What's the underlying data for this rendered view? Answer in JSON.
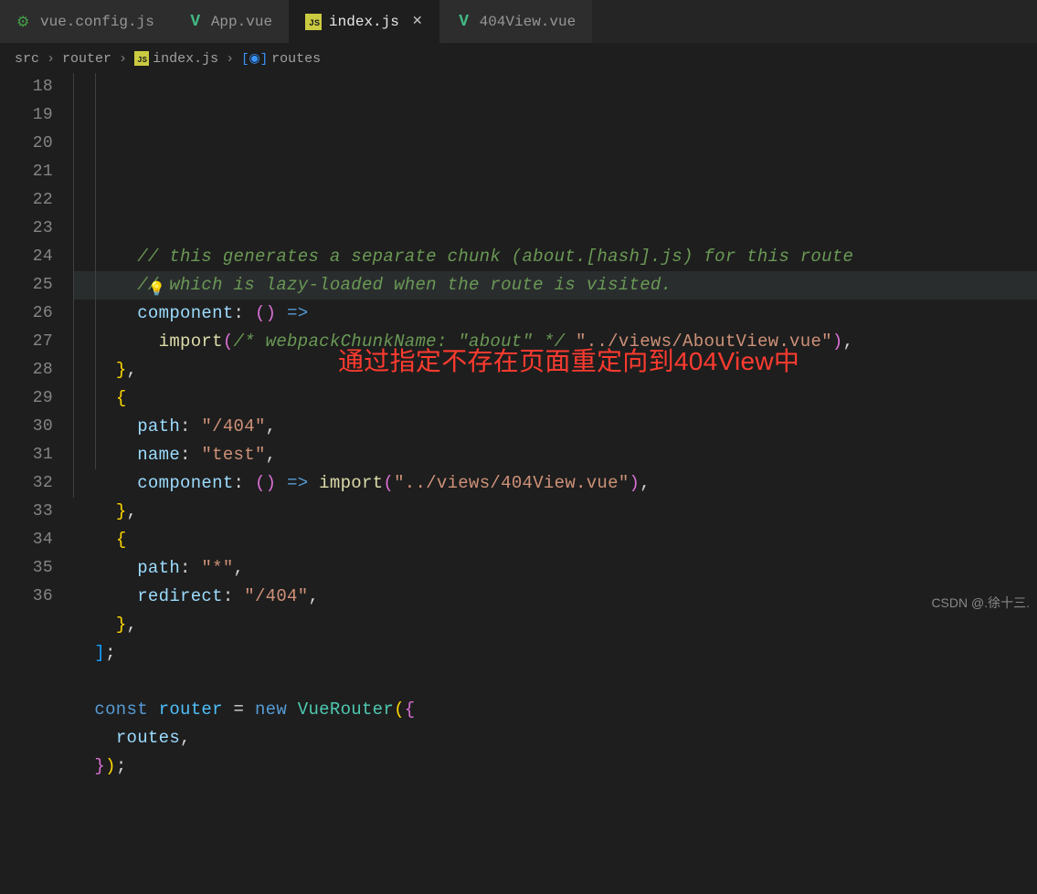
{
  "tabs": [
    {
      "label": "vue.config.js",
      "icon": "config"
    },
    {
      "label": "App.vue",
      "icon": "vue"
    },
    {
      "label": "index.js",
      "icon": "js",
      "active": true
    },
    {
      "label": "404View.vue",
      "icon": "vue"
    }
  ],
  "breadcrumb": {
    "parts": [
      "src",
      "router"
    ],
    "file": "index.js",
    "symbol": "routes"
  },
  "lines": {
    "start": 18,
    "end": 36,
    "highlight": 25
  },
  "code": {
    "l18": "// this generates a separate chunk (about.[hash].js) for this route",
    "l19": "// which is lazy-loaded when the route is visited.",
    "l20_prop": "component",
    "l21_import": "import",
    "l21_comment": "/* webpackChunkName: \"about\" */",
    "l21_str": "\"../views/AboutView.vue\"",
    "l24_prop": "path",
    "l24_str": "\"/404\"",
    "l25_prop": "name",
    "l25_str": "\"test\"",
    "l26_prop": "component",
    "l26_import": "import",
    "l26_str": "\"../views/404View.vue\"",
    "l29_prop": "path",
    "l29_str": "\"*\"",
    "l30_prop": "redirect",
    "l30_str": "\"/404\"",
    "l34_const": "const",
    "l34_var": "router",
    "l34_new": "new",
    "l34_class": "VueRouter",
    "l35_prop": "routes"
  },
  "annotation": "通过指定不存在页面重定向到404View中",
  "watermark": "CSDN @.徐十三."
}
